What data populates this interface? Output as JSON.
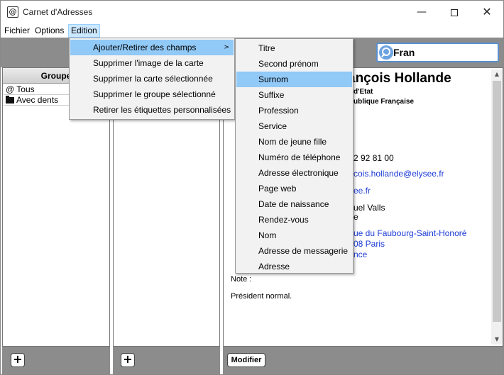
{
  "window": {
    "icon": "@",
    "title": "Carnet d'Adresses",
    "minimize_glyph": "—",
    "close_glyph": "✕"
  },
  "menubar": {
    "items": [
      "Fichier",
      "Options",
      "Edition"
    ]
  },
  "search": {
    "value": "Fran",
    "icon": "magnifier-icon"
  },
  "groups": {
    "header": "Groupe",
    "items": [
      "@ Tous",
      "Avec dents"
    ]
  },
  "edition_menu": {
    "items": [
      "Ajouter/Retirer des champs",
      "Supprimer l'image de la carte",
      "Supprimer la carte sélectionnée",
      "Supprimer le groupe sélectionné",
      "Retirer les étiquettes personnalisées"
    ],
    "submenu_arrow": ">"
  },
  "fields_submenu": {
    "items": [
      "Titre",
      "Second prénom",
      "Surnom",
      "Suffixe",
      "Profession",
      "Service",
      "Nom de jeune fille",
      "Numéro de téléphone",
      "Adresse électronique",
      "Page web",
      "Date de naissance",
      "Rendez-vous",
      "Nom",
      "Adresse de messagerie",
      "Adresse"
    ],
    "highlighted": "Surnom"
  },
  "contact": {
    "name": "ançois Hollande",
    "title": "d'Etat",
    "org": "ublique Française",
    "phone": "2 92 81 00",
    "email": "cois.hollande@elysee.fr",
    "web": "ee.fr",
    "related": "uel Valls",
    "related2": "e",
    "address_line1": "ue du Faubourg-Saint-Honoré",
    "address_line2": "08 Paris",
    "address_line3": "nce",
    "note_label": "Note :",
    "note": "Président normal."
  },
  "footer": {
    "add_group": "+",
    "add_card": "+",
    "modify": "Modifier"
  },
  "colors": {
    "toolbar_gray": "#8c8c8c",
    "link_blue": "#1a3ad6",
    "menu_highlight": "#91c9f7"
  }
}
